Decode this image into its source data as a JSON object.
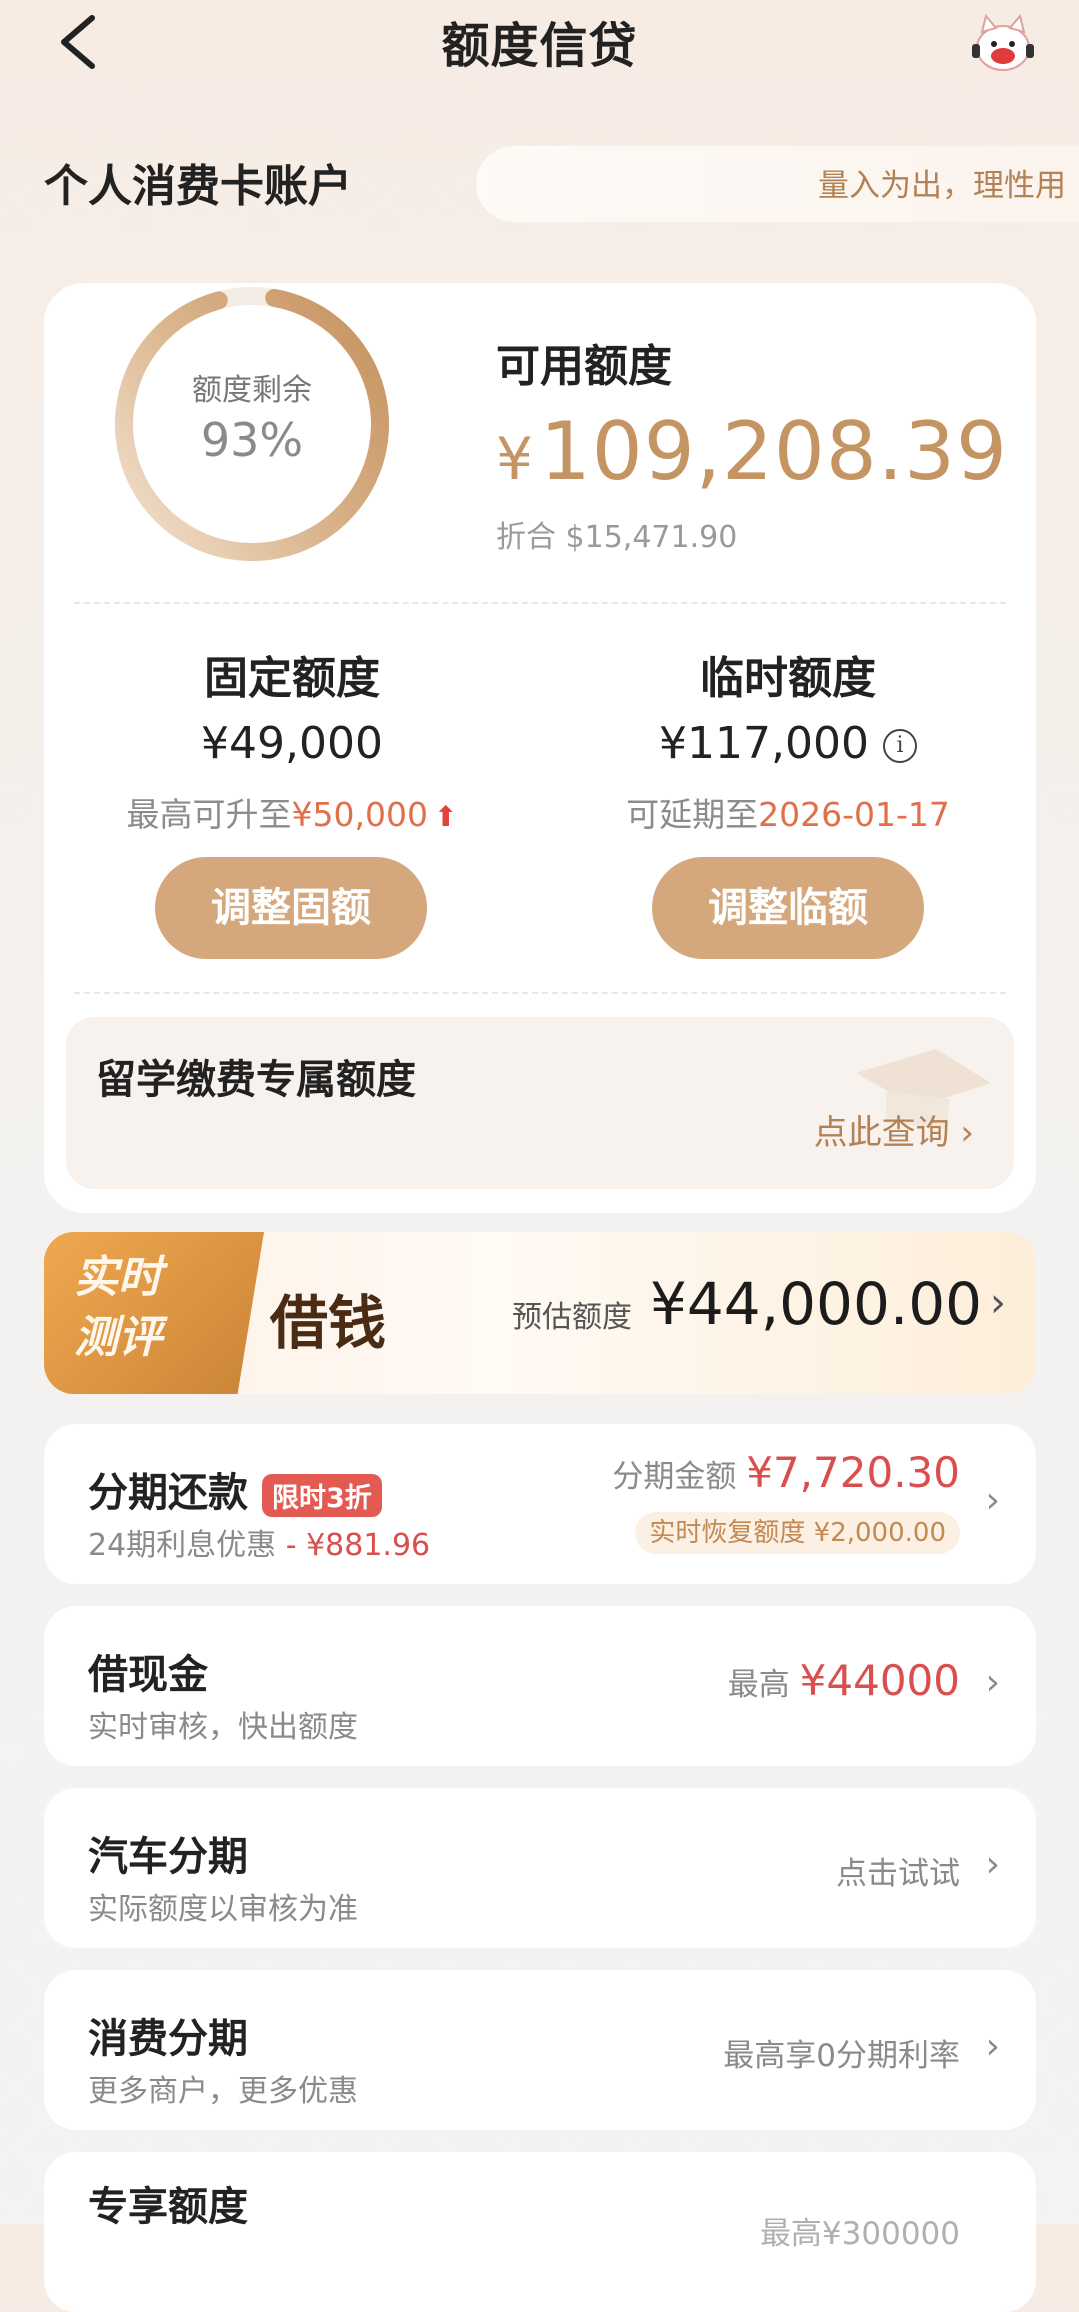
{
  "header": {
    "title": "额度信贷"
  },
  "account": {
    "title": "个人消费卡账户",
    "slogan": "量入为出，理性用"
  },
  "credit": {
    "ring_label": "额度剩余",
    "ring_value": "93%",
    "remaining_fraction": 0.93,
    "available_label": "可用额度",
    "available_currency": "¥",
    "available_amount": "109,208.39",
    "converted": "折合 $15,471.90"
  },
  "fixed": {
    "title": "固定额度",
    "amount": "¥49,000",
    "sub_prefix": "最高可升至",
    "sub_value": "¥50,000",
    "button": "调整固额"
  },
  "temporary": {
    "title": "临时额度",
    "amount": "¥117,000",
    "sub_prefix": "可延期至",
    "sub_value": "2026-01-17",
    "button": "调整临额"
  },
  "study": {
    "title": "留学缴费专属额度",
    "link": "点此查询"
  },
  "loan": {
    "tag_line1": "实时",
    "tag_line2": "测评",
    "title": "借钱",
    "estimate_label": "预估额度",
    "estimate_amount": "¥44,000.00"
  },
  "list": {
    "installment": {
      "title": "分期还款",
      "badge": "限时3折",
      "sub_prefix": "24期利息优惠",
      "sub_value": " - ¥881.96",
      "right_label": "分期金额",
      "right_amount": "¥7,720.30",
      "recover": "实时恢复额度 ¥2,000.00"
    },
    "cash": {
      "title": "借现金",
      "sub": "实时审核，快出额度",
      "right_label": "最高",
      "right_amount": "¥44000"
    },
    "car": {
      "title": "汽车分期",
      "sub": "实际额度以审核为准",
      "right": "点击试试"
    },
    "consume": {
      "title": "消费分期",
      "sub": "更多商户，更多优惠",
      "right": "最高享0分期利率"
    },
    "exclusive": {
      "title": "专享额度",
      "right": "最高¥300000"
    }
  },
  "colors": {
    "accent": "#c59463",
    "button": "#d4a77c",
    "highlight_red": "#d94f4f",
    "orange": "#e0704a"
  }
}
